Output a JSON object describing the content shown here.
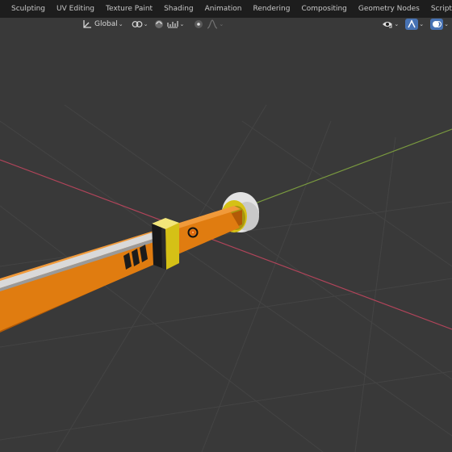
{
  "workspace_tabs": [
    {
      "label": "Sculpting"
    },
    {
      "label": "UV Editing"
    },
    {
      "label": "Texture Paint"
    },
    {
      "label": "Shading"
    },
    {
      "label": "Animation"
    },
    {
      "label": "Rendering"
    },
    {
      "label": "Compositing"
    },
    {
      "label": "Geometry Nodes"
    },
    {
      "label": "Scripting"
    }
  ],
  "add_workspace_label": "+",
  "header": {
    "orientation_label": "Global",
    "icons": {
      "orientation": "transform-orientation-icon",
      "pivot": "pivot-point-icon",
      "snap": "snap-icon",
      "snap_target": "snap-increment-icon",
      "proportional": "proportional-editing-icon",
      "falloff": "falloff-curve-icon",
      "visibility": "object-visibility-icon",
      "gizmo": "gizmo-toggle-icon",
      "overlay": "overlay-toggle-icon"
    }
  },
  "colors": {
    "background": "#393939",
    "topbar": "#1d1d1d",
    "accent": "#4772b3",
    "x_axis": "#b1445a",
    "y_axis": "#7a9a3f",
    "staff_orange": "#e07c10",
    "gold_band": "#d5c116",
    "cap_white": "#e3e3e3"
  },
  "scene": {
    "object": "staff-mesh",
    "origin_marker": "object-origin-icon"
  }
}
